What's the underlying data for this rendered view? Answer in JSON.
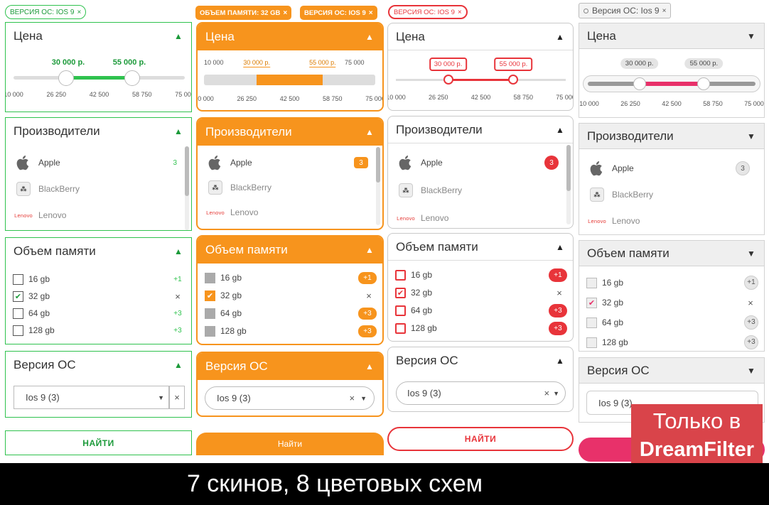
{
  "colors": {
    "green": "#2fc24e",
    "orange": "#f7941d",
    "red": "#e8343a",
    "pink": "#e8316a",
    "grey": "#efefef",
    "ribbon": "#d9444a"
  },
  "tags": {
    "s1": [
      "ВЕРСИЯ ОС: IOS 9"
    ],
    "s2": [
      "ОБЪЕМ ПАМЯТИ: 32 GB",
      "ВЕРСИЯ ОС: IOS 9"
    ],
    "s3": [
      "ВЕРСИЯ ОС: IOS 9"
    ],
    "s4": [
      "Версия ОС: Ios 9"
    ]
  },
  "close_glyph": "×",
  "sections": {
    "price": "Цена",
    "brands": "Производители",
    "memory": "Объем памяти",
    "os": "Версия ОС"
  },
  "price": {
    "from_label": "30 000 р.",
    "to_label": "55 000 р.",
    "from": 30000,
    "to": 55000,
    "min": 10000,
    "max": 75000,
    "ticks": [
      "10 000",
      "26 250",
      "42 500",
      "58 750",
      "75 000"
    ]
  },
  "brands": [
    {
      "name": "Apple",
      "count": "3",
      "icon": "apple-icon"
    },
    {
      "name": "BlackBerry",
      "icon": "blackberry-icon"
    },
    {
      "name": "Lenovo",
      "icon": "lenovo-logo",
      "logo_text": "Lenovo"
    }
  ],
  "memory": [
    {
      "name": "16 gb",
      "count": "+1",
      "checked": false
    },
    {
      "name": "32 gb",
      "count": "×",
      "checked": true
    },
    {
      "name": "64 gb",
      "count": "+3",
      "checked": false
    },
    {
      "name": "128 gb",
      "count": "+3",
      "checked": false
    }
  ],
  "os_select": {
    "value": "Ios 9  (3)"
  },
  "buttons": {
    "s1": "НАЙТИ",
    "s2": "Найти",
    "s3": "НАЙТИ"
  },
  "banner": {
    "text": "7 скинов, 8 цветовых схем"
  },
  "ribbon": {
    "line1": "Только в",
    "line2": "DreamFilter"
  }
}
